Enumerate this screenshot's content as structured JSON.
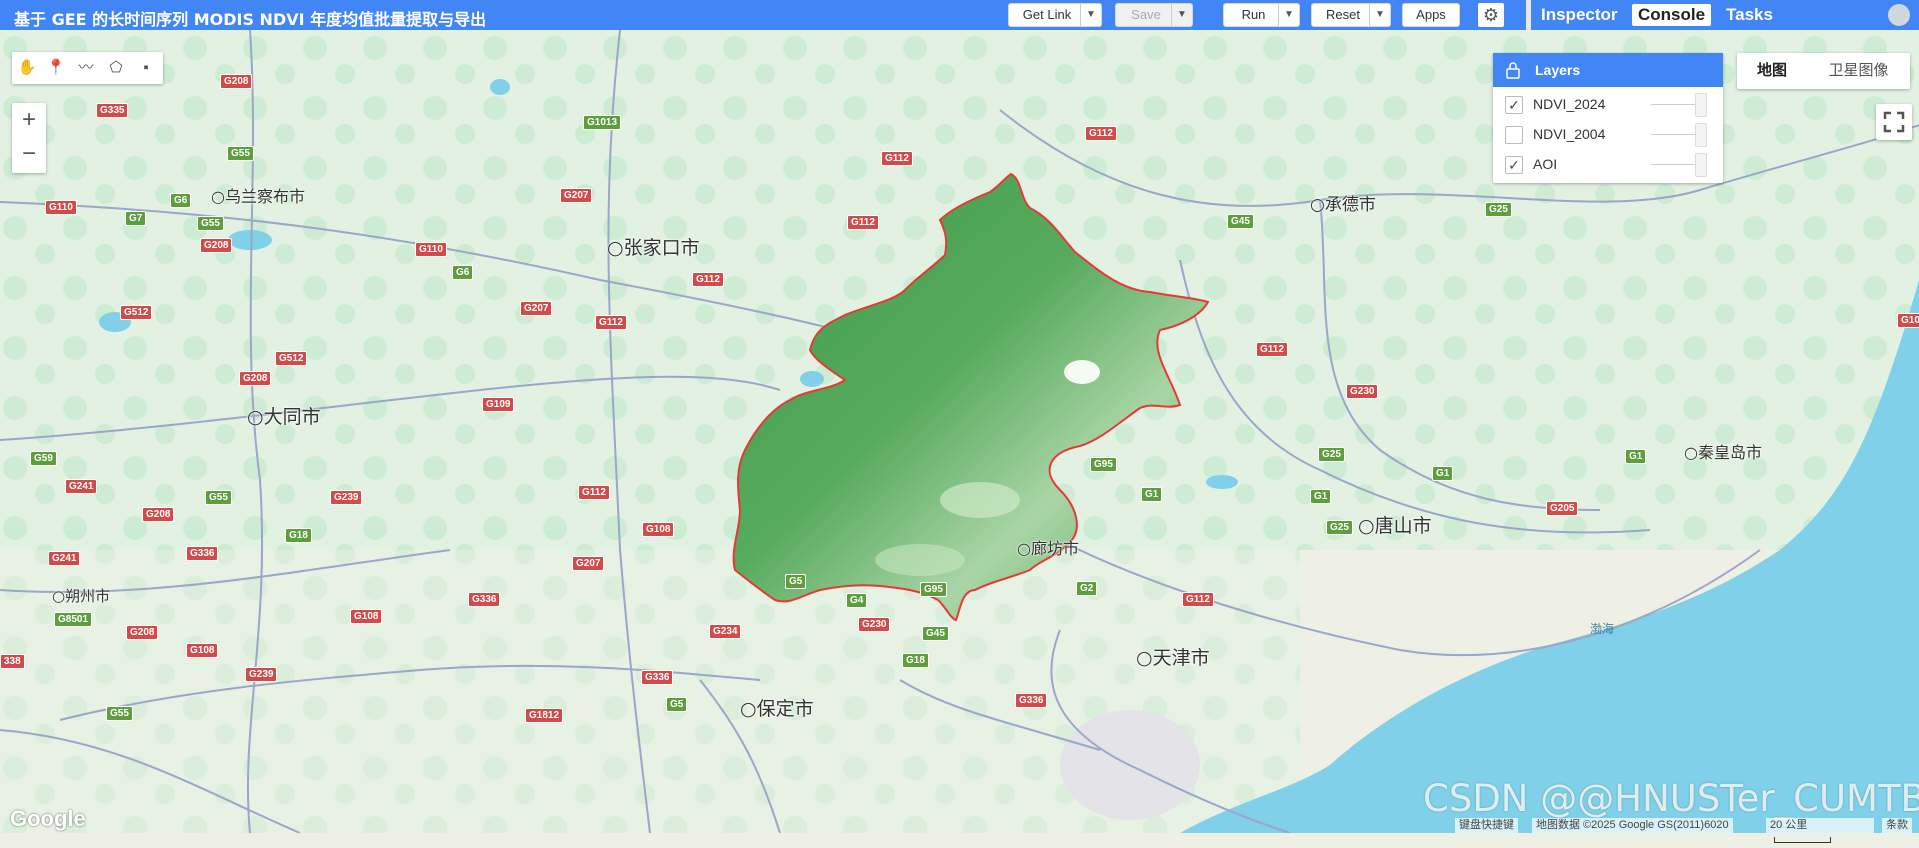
{
  "app": {
    "title": "基于 GEE 的长时间序列 MODIS NDVI 年度均值批量提取与导出"
  },
  "toolbar": {
    "get_link": "Get Link",
    "save": "Save",
    "run": "Run",
    "reset": "Reset",
    "apps": "Apps"
  },
  "right_tabs": {
    "inspector": "Inspector",
    "console": "Console",
    "tasks": "Tasks"
  },
  "layers": {
    "header": "Layers",
    "items": [
      {
        "name": "NDVI_2024",
        "checked": true
      },
      {
        "name": "NDVI_2004",
        "checked": false
      },
      {
        "name": "AOI",
        "checked": true
      }
    ]
  },
  "map_type": {
    "map": "地图",
    "satellite": "卫星图像"
  },
  "zoom": {
    "in": "+",
    "out": "−"
  },
  "cities": [
    {
      "name": "乌兰察布市"
    },
    {
      "name": "张家口市"
    },
    {
      "name": "承德市"
    },
    {
      "name": "大同市"
    },
    {
      "name": "秦皇岛市"
    },
    {
      "name": "唐山市"
    },
    {
      "name": "廊坊市"
    },
    {
      "name": "朔州市"
    },
    {
      "name": "天津市"
    },
    {
      "name": "保定市"
    }
  ],
  "sea_label": "渤海",
  "road_labels": {
    "g208a": "G208",
    "g335": "G335",
    "g1013": "G1013",
    "g55a": "G55",
    "g6a": "G6",
    "g110a": "G110",
    "g7": "G7",
    "g55b": "G55",
    "g208b": "G208",
    "g110b": "G110",
    "g207a": "G207",
    "g112a": "G112",
    "g112b": "G112",
    "g112c": "G112",
    "g6b": "G6",
    "g112d": "G112",
    "g207b": "G207",
    "g512a": "G512",
    "g112e": "G112",
    "g512b": "G512",
    "g208c": "G208",
    "g109": "G109",
    "g45a": "G45",
    "g25a": "G25",
    "g112f": "G112",
    "g230a": "G230",
    "g59": "G59",
    "g241a": "G241",
    "g55c": "G55",
    "g239a": "G239",
    "g112g": "G112",
    "g208d": "G208",
    "g18a": "G18",
    "g336a": "G336",
    "g108a": "G108",
    "g207c": "G207",
    "g241b": "G241",
    "g95a": "G95",
    "g1a": "G1",
    "g25b": "G25",
    "g1b": "G1",
    "g1c": "G1",
    "g1d": "G1",
    "g205": "G205",
    "g25c": "G25",
    "g8501": "G8501",
    "g336b": "G336",
    "g108b": "G108",
    "g208e": "G208",
    "g108c": "G108",
    "g5a": "G5",
    "g95b": "G95",
    "g4": "G4",
    "g2": "G2",
    "g112h": "G112",
    "g234": "G234",
    "g230b": "G230",
    "g45b": "G45",
    "g18b": "G18",
    "g239b": "G239",
    "g336c": "G336",
    "g336d": "G336",
    "g5b": "G5",
    "g55d": "G55",
    "g1812": "G1812",
    "g338": "338",
    "g110c": "G10"
  },
  "footer": {
    "shortcuts": "键盘快捷键",
    "attribution": "地图数据 ©2025 Google GS(2011)6020",
    "scale": "20 公里",
    "terms": "条款"
  },
  "google_logo": "Google",
  "watermark": "CSDN @@HNUSTer_CUMTBer",
  "colors": {
    "accent": "#4285f4",
    "aoi_outline": "#e53935",
    "ndvi_fill": "#3f9f4f",
    "sea": "#7fd0e8",
    "land": "#eef0e6",
    "vegetation": "#c8ead2",
    "road": "#9aa7c8",
    "road_shield_red": "#d24b4b",
    "road_shield_green": "#5e9e3e"
  }
}
